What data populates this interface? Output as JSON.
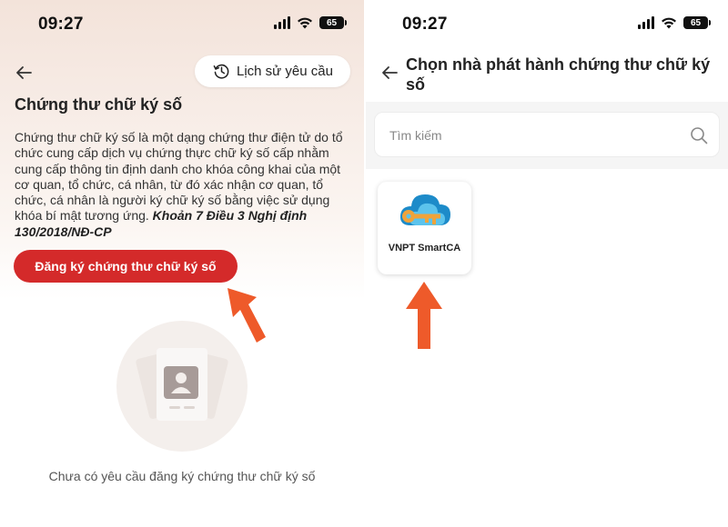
{
  "left_screen": {
    "status": {
      "time": "09:27",
      "battery": "65"
    },
    "history_button_label": "Lịch sử yêu cầu",
    "title": "Chứng thư chữ ký số",
    "description": "Chứng thư chữ ký số là một dạng chứng thư điện tử do tổ chức cung cấp dịch vụ chứng thực chữ ký số cấp nhằm cung cấp thông tin định danh cho khóa công khai của một cơ quan, tổ chức, cá nhân, từ đó xác nhận cơ quan, tổ chức, cá nhân là người ký chữ ký số bằng việc sử dụng khóa bí mật tương ứng.",
    "legal_reference": "Khoản 7 Điều 3 Nghị định 130/2018/NĐ-CP",
    "register_button_label": "Đăng ký chứng thư chữ ký số",
    "empty_state_text": "Chưa có yêu cầu đăng ký chứng thư chữ ký số"
  },
  "right_screen": {
    "status": {
      "time": "09:27",
      "battery": "65"
    },
    "title": "Chọn nhà phát hành chứng thư chữ ký số",
    "search": {
      "placeholder": "Tìm kiếm",
      "value": ""
    },
    "issuers": [
      {
        "name": "VNPT SmartCA",
        "icon": "cloud-key-logo"
      }
    ]
  },
  "colors": {
    "accent": "#d42a2a",
    "annotation_arrow": "#ee5a2a",
    "header_tint": "#f3e3da"
  }
}
